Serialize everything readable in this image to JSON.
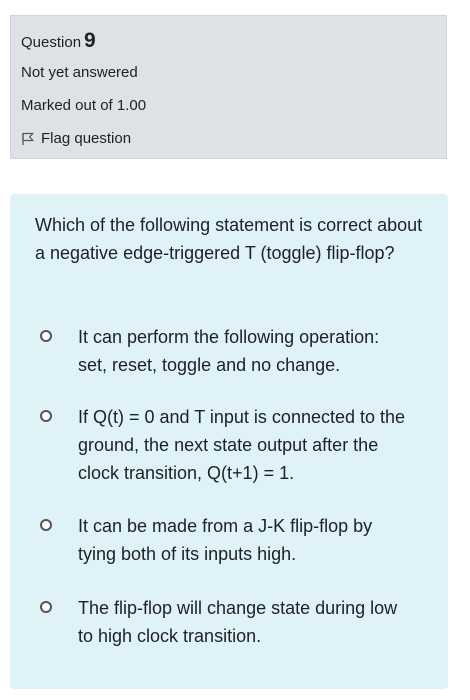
{
  "info": {
    "question_label": "Question",
    "question_number": "9",
    "state": "Not yet answered",
    "grade": "Marked out of 1.00",
    "flag_label": "Flag question"
  },
  "question": {
    "text": "Which of the following statement is correct about a negative edge-triggered T (toggle) flip-flop?",
    "options": [
      "It can perform the following operation: set, reset, toggle and no change.",
      "If Q(t) = 0 and T input is connected to the ground, the next state output after the clock transition, Q(t+1) = 1.",
      "It can be made from a J-K flip-flop by tying both of its inputs high.",
      "The flip-flop will change state during low to high clock transition."
    ]
  }
}
